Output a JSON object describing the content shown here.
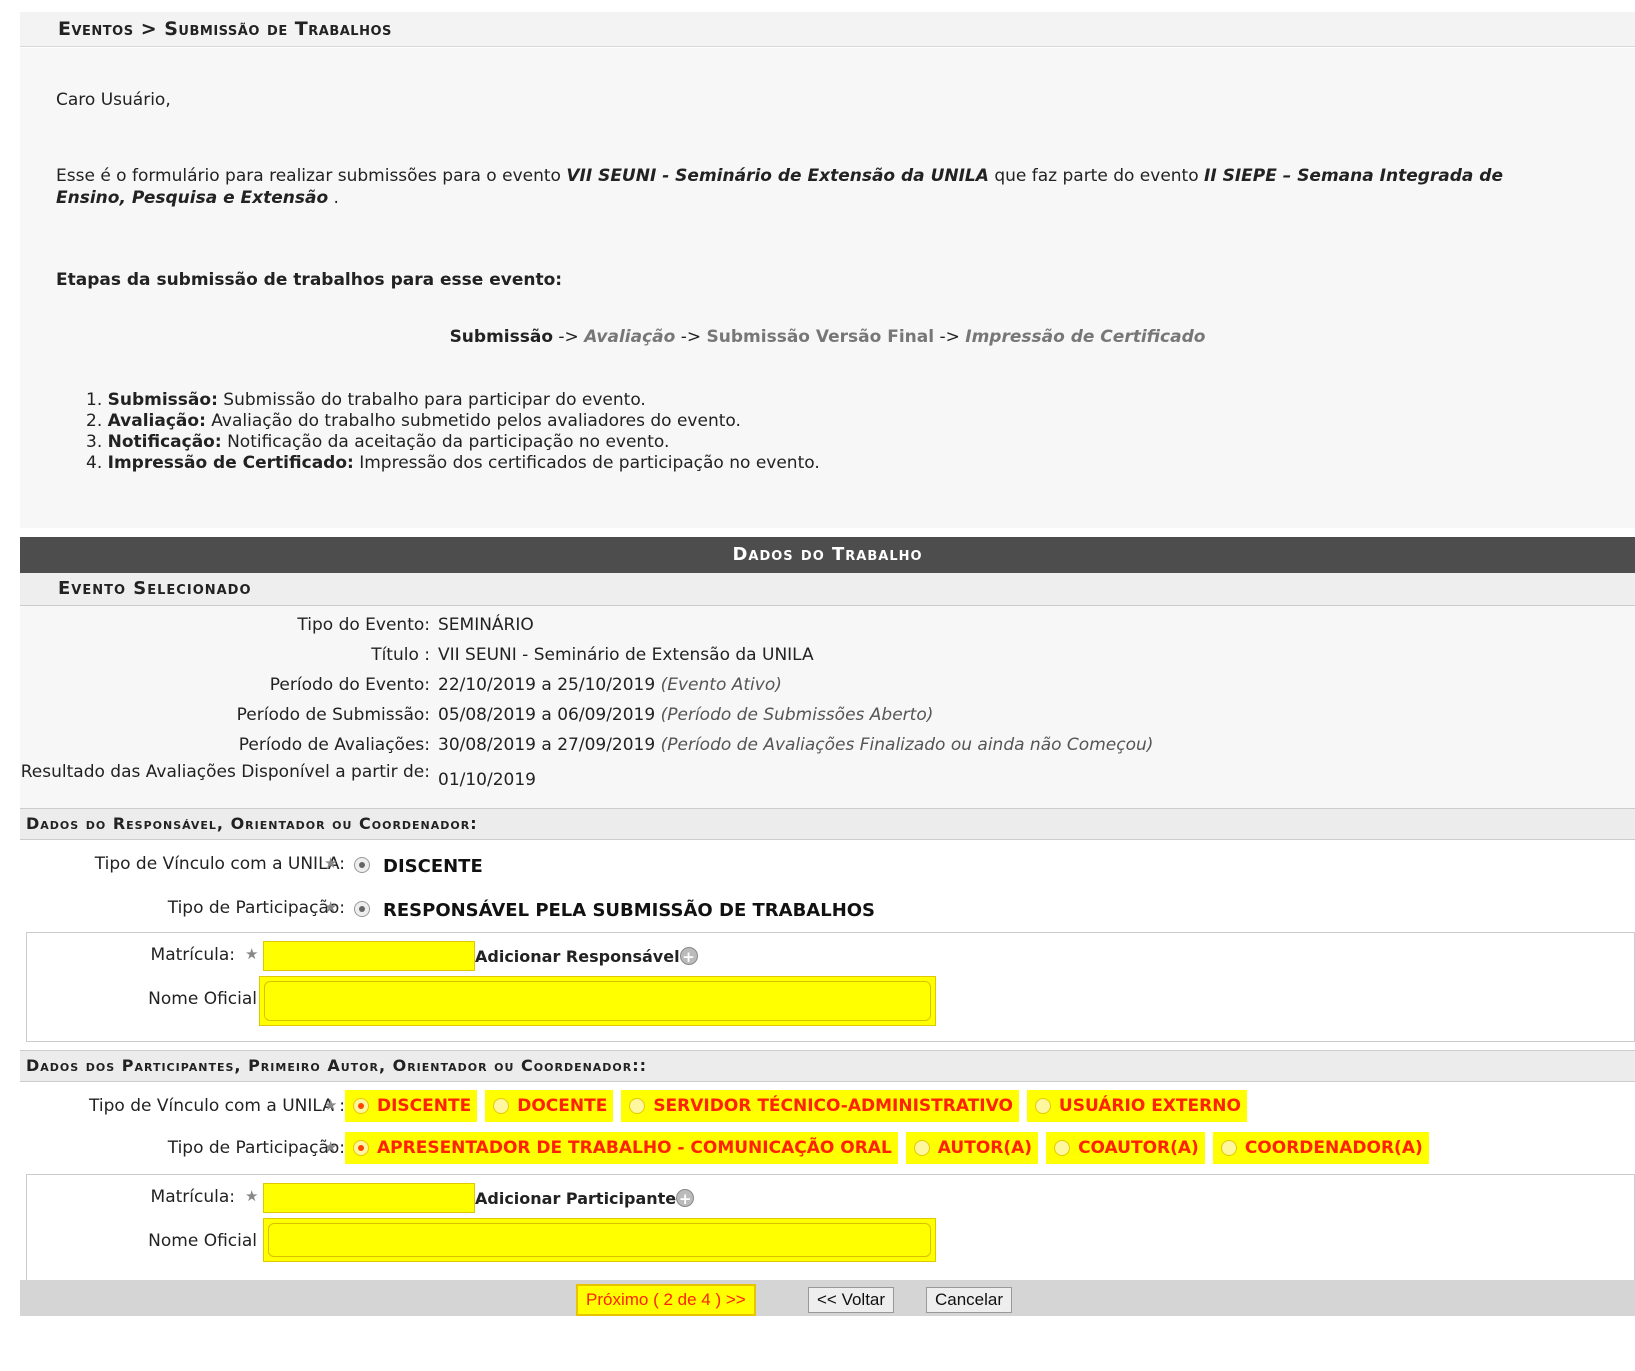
{
  "breadcrumb": "Eventos > Submissão de Trabalhos",
  "intro": {
    "greeting": "Caro Usuário,",
    "text_before": "Esse é o formulário para realizar submissões para o evento ",
    "event_name": "VII SEUNI - Seminário de Extensão da UNILA",
    "text_middle": " que faz parte do evento ",
    "parent_event": "II SIEPE – Semana Integrada de Ensino, Pesquisa e Extensão",
    "text_after": " .",
    "steps_title": "Etapas da submissão de trabalhos para esse evento:",
    "flow": {
      "s1": "Submissão",
      "s2": "Avaliação",
      "s3": "Submissão Versão Final",
      "s4": "Impressão de Certificado",
      "arrow": " -> "
    },
    "steps": [
      {
        "num": "1. ",
        "title": "Submissão:",
        "desc": " Submissão do trabalho para participar do evento."
      },
      {
        "num": "2. ",
        "title": "Avaliação:",
        "desc": " Avaliação do trabalho submetido pelos avaliadores do evento."
      },
      {
        "num": "3. ",
        "title": "Notificação:",
        "desc": " Notificação da aceitação da participação no evento."
      },
      {
        "num": "4. ",
        "title": "Impressão de Certificado:",
        "desc": " Impressão dos certificados de participação no evento."
      }
    ]
  },
  "form": {
    "title": "Dados do Trabalho",
    "event_section": "Evento Selecionado",
    "event": {
      "tipo_label": "Tipo do Evento:",
      "tipo_value": "SEMINÁRIO",
      "titulo_label": "Título :",
      "titulo_value": "VII SEUNI - Seminário de Extensão da UNILA",
      "periodo_label": "Período do Evento:",
      "periodo_value": "22/10/2019 a 25/10/2019",
      "periodo_note": "(Evento Ativo)",
      "submissao_label": "Período de Submissão:",
      "submissao_value": "05/08/2019 a 06/09/2019",
      "submissao_note": "(Período de Submissões Aberto)",
      "avaliacoes_label": "Período de Avaliações:",
      "avaliacoes_value": "30/08/2019 a 27/09/2019",
      "avaliacoes_note": "(Período de Avaliações Finalizado ou ainda não Começou)",
      "resultado_label": "Resultado das Avaliações Disponível a partir de:",
      "resultado_value": "01/10/2019"
    },
    "responsavel": {
      "section": "Dados do Responsável, Orientador ou Coordenador:",
      "vinculo_label": "Tipo de Vínculo com a UNILA:",
      "vinculo_value": "DISCENTE",
      "participacao_label": "Tipo de Participação:",
      "participacao_value": "RESPONSÁVEL PELA SUBMISSÃO DE TRABALHOS",
      "matricula_label": "Matrícula:",
      "matricula_value": "",
      "add_label": "Adicionar Responsável",
      "nome_label": "Nome Oficial",
      "nome_value": ""
    },
    "participantes": {
      "section": "Dados dos Participantes, Primeiro Autor, Orientador ou Coordenador::",
      "vinculo_label": "Tipo de Vínculo com a UNILA :",
      "vinculo_options": [
        "DISCENTE",
        "DOCENTE",
        "SERVIDOR TÉCNICO-ADMINISTRATIVO",
        "USUÁRIO EXTERNO"
      ],
      "participacao_label": "Tipo de Participação:",
      "participacao_options": [
        "APRESENTADOR DE TRABALHO - COMUNICAÇÃO ORAL",
        "AUTOR(A)",
        "COAUTOR(A)",
        "COORDENADOR(A)"
      ],
      "matricula_label": "Matrícula:",
      "matricula_value": "",
      "add_label": "Adicionar Participante",
      "nome_label": "Nome Oficial",
      "nome_value": ""
    },
    "buttons": {
      "next": "Próximo ( 2 de 4 ) >>",
      "back": "<< Voltar",
      "cancel": "Cancelar"
    }
  },
  "colors": {
    "highlight": "#ffff00",
    "highlight_text": "#ff2200",
    "header_bg": "#4d4d4d"
  }
}
